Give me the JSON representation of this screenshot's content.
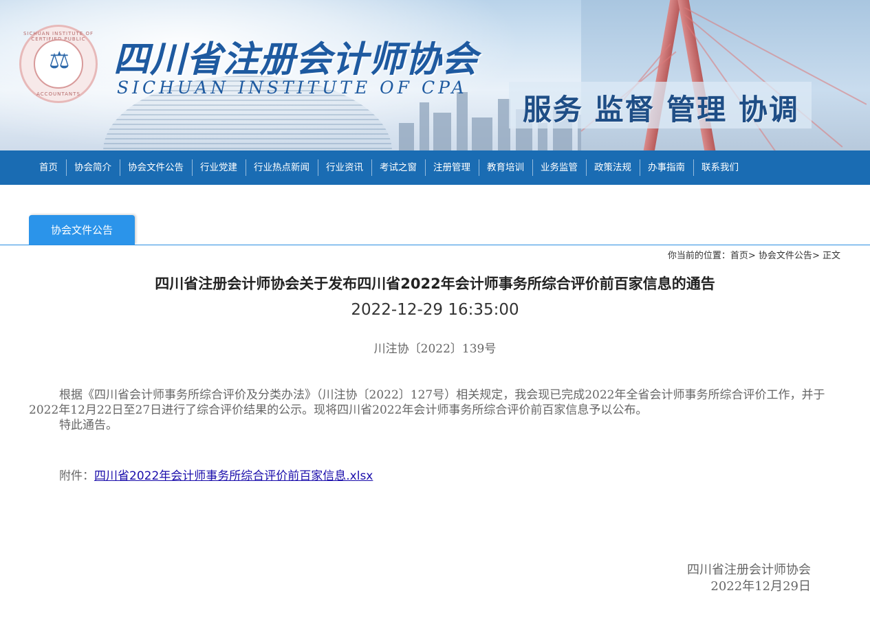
{
  "header": {
    "logo_ring_top": "SICHUAN INSTITUTE OF CERTIFIED PUBLIC",
    "logo_ring_bottom": "ACCOUNTANTS",
    "title_cn": "四川省注册会计师协会",
    "title_en": "SICHUAN INSTITUTE OF CPA",
    "slogan": "服务 监督 管理 协调"
  },
  "nav": {
    "items": [
      {
        "label": "首页"
      },
      {
        "label": "协会简介"
      },
      {
        "label": "协会文件公告"
      },
      {
        "label": "行业党建"
      },
      {
        "label": "行业热点新闻"
      },
      {
        "label": "行业资讯"
      },
      {
        "label": "考试之窗"
      },
      {
        "label": "注册管理"
      },
      {
        "label": "教育培训"
      },
      {
        "label": "业务监管"
      },
      {
        "label": "政策法规"
      },
      {
        "label": "办事指南"
      },
      {
        "label": "联系我们"
      }
    ]
  },
  "column_tab": "协会文件公告",
  "breadcrumb": {
    "prefix": "你当前的位置：",
    "home": "首页",
    "section": "协会文件公告",
    "current": "正文",
    "sep": ">"
  },
  "article": {
    "title": "四川省注册会计师协会关于发布四川省2022年会计师事务所综合评价前百家信息的通告",
    "datetime": "2022-12-29 16:35:00",
    "doc_number": "川注协〔2022〕139号",
    "paragraphs": [
      "根据《四川省会计师事务所综合评价及分类办法》（川注协〔2022〕127号）相关规定，我会现已完成2022年全省会计师事务所综合评价工作，并于2022年12月22日至27日进行了综合评价结果的公示。现将四川省2022年会计师事务所综合评价前百家信息予以公布。",
      "特此通告。"
    ],
    "attachment_label": "附件：",
    "attachment_link": "四川省2022年会计师事务所综合评价前百家信息.xlsx",
    "signature_org": "四川省注册会计师协会",
    "signature_date": "2022年12月29日"
  }
}
